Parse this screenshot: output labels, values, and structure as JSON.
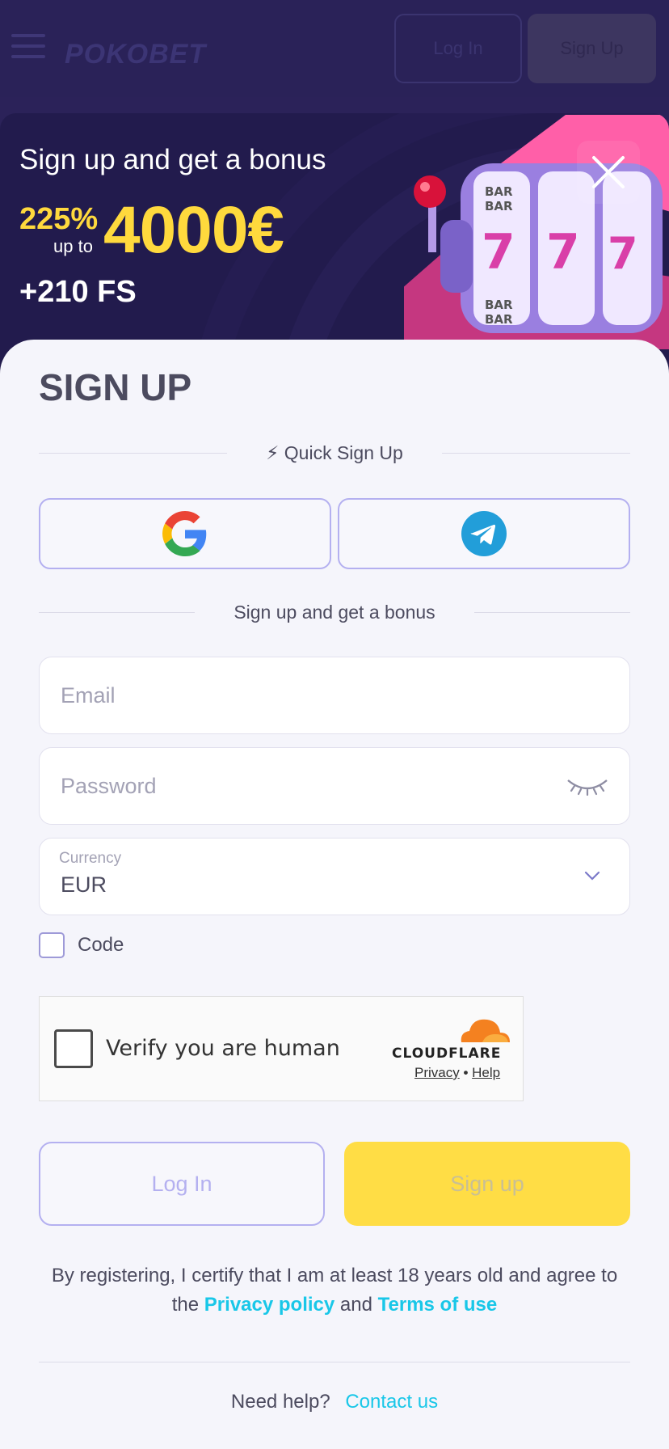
{
  "header": {
    "logo": "POKOBET",
    "login_label": "Log In",
    "signup_label": "Sign Up"
  },
  "banner": {
    "title": "Sign up and get a bonus",
    "percent": "225%",
    "up_to": "up to",
    "amount": "4000€",
    "free_spins": "+210 FS"
  },
  "form": {
    "title": "SIGN UP",
    "quick_label": "⚡ Quick Sign Up",
    "bonus_divider": "Sign up and get a bonus",
    "email_placeholder": "Email",
    "password_placeholder": "Password",
    "currency_label": "Currency",
    "currency_value": "EUR",
    "code_label": "Code",
    "captcha_text": "Verify you are human",
    "captcha_brand": "CLOUDFLARE",
    "captcha_privacy": "Privacy",
    "captcha_sep": " • ",
    "captcha_help": "Help",
    "login_label": "Log In",
    "signup_label": "Sign up",
    "legal_prefix": "By registering, I certify that I am at least 18 years old and agree to the",
    "privacy_link": "Privacy policy",
    "legal_and": "and",
    "terms_link": "Terms of use",
    "help_text": "Need help?",
    "contact_link": "Contact us"
  },
  "colors": {
    "accent_yellow": "#ffdd45",
    "link_cyan": "#19c7e8",
    "outline_purple": "#b4b0f0",
    "banner_bg": "#221b4d"
  },
  "icons": [
    "menu-icon",
    "close-icon",
    "google-icon",
    "telegram-icon",
    "eye-closed-icon",
    "chevron-down-icon",
    "cloudflare-icon"
  ]
}
